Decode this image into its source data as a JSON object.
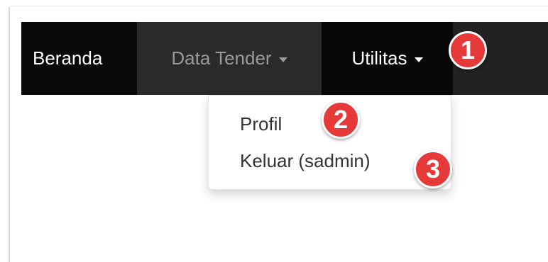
{
  "navbar": {
    "items": [
      {
        "label": "Beranda"
      },
      {
        "label": "Data Tender"
      },
      {
        "label": "Utilitas"
      }
    ]
  },
  "dropdown": {
    "items": [
      {
        "label": "Profil"
      },
      {
        "label": "Keluar (sadmin)"
      }
    ]
  },
  "annotations": {
    "badges": [
      "1",
      "2",
      "3"
    ],
    "color": "#e63a3a"
  },
  "colors": {
    "navbar_bg": "#222222",
    "active_bg": "#080808",
    "muted_text": "#9a9a9a"
  }
}
